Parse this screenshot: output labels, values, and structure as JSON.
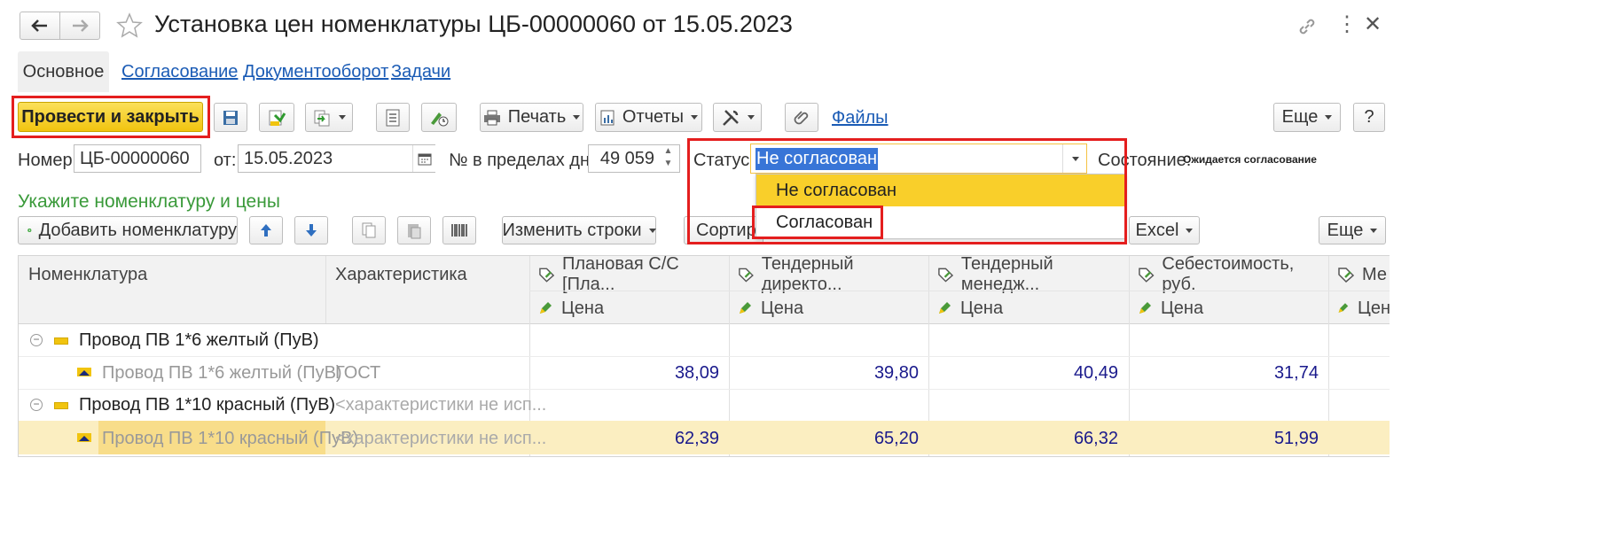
{
  "window": {
    "title": "Установка цен номенклатуры ЦБ-00000060 от 15.05.2023"
  },
  "tabs": [
    {
      "label": "Основное"
    },
    {
      "label": "Согласование"
    },
    {
      "label": "Документооборот"
    },
    {
      "label": "Задачи"
    }
  ],
  "toolbar": {
    "post_close": "Провести и закрыть",
    "print": "Печать",
    "reports": "Отчеты",
    "files": "Файлы",
    "more": "Еще",
    "help": "?"
  },
  "header_fields": {
    "number_label": "Номер:",
    "number_value": "ЦБ-00000060",
    "date_label": "от:",
    "date_value": "15.05.2023",
    "day_label": "№ в пределах дня:",
    "day_value": "49 059",
    "status_label": "Статус:",
    "status_value": "Не согласован",
    "state_label": "Состояние:",
    "state_value": "Ожидается согласование"
  },
  "status_dropdown": {
    "options": [
      "Не согласован",
      "Согласован"
    ],
    "highlighted": "Не согласован"
  },
  "section": {
    "title": "Укажите номенклатуру и цены"
  },
  "table_toolbar": {
    "add_item": "Добавить номенклатуру",
    "change_rows": "Изменить строки",
    "sort": "Сортиров",
    "excel": "Excel",
    "more": "Еще"
  },
  "table": {
    "columns": [
      {
        "title": "Номенклатура",
        "sub": ""
      },
      {
        "title": "Характеристика",
        "sub": ""
      },
      {
        "title": "Плановая С/С [Пла...",
        "sub": "Цена"
      },
      {
        "title": "Тендерный директо...",
        "sub": "Цена"
      },
      {
        "title": "Тендерный менедж...",
        "sub": "Цена"
      },
      {
        "title": "Себестоимость, руб.",
        "sub": "Цена"
      },
      {
        "title": "Ме",
        "sub": "Цен"
      }
    ],
    "rows": [
      {
        "type": "group",
        "name": "Провод ПВ 1*6 желтый (ПуВ)",
        "char": "",
        "prices": []
      },
      {
        "type": "item",
        "name": "Провод ПВ 1*6 желтый (ПуВ)",
        "char": "ГОСТ",
        "prices": [
          "38,09",
          "39,80",
          "40,49",
          "31,74"
        ]
      },
      {
        "type": "group",
        "name": "Провод ПВ 1*10 красный (ПуВ)",
        "char": "<характеристики не исп...",
        "prices": []
      },
      {
        "type": "item",
        "name": "Провод ПВ 1*10 красный (ПуВ)",
        "char": "<характеристики не исп...",
        "prices": [
          "62,39",
          "65,20",
          "66,32",
          "51,99"
        ],
        "selected": true
      }
    ]
  },
  "colors": {
    "accent_yellow": "#f5d01e",
    "highlight_red": "#e41e1e",
    "section_green": "#3a9a3a",
    "link_blue": "#1a5bb5",
    "selected_row": "#fbeec1"
  }
}
